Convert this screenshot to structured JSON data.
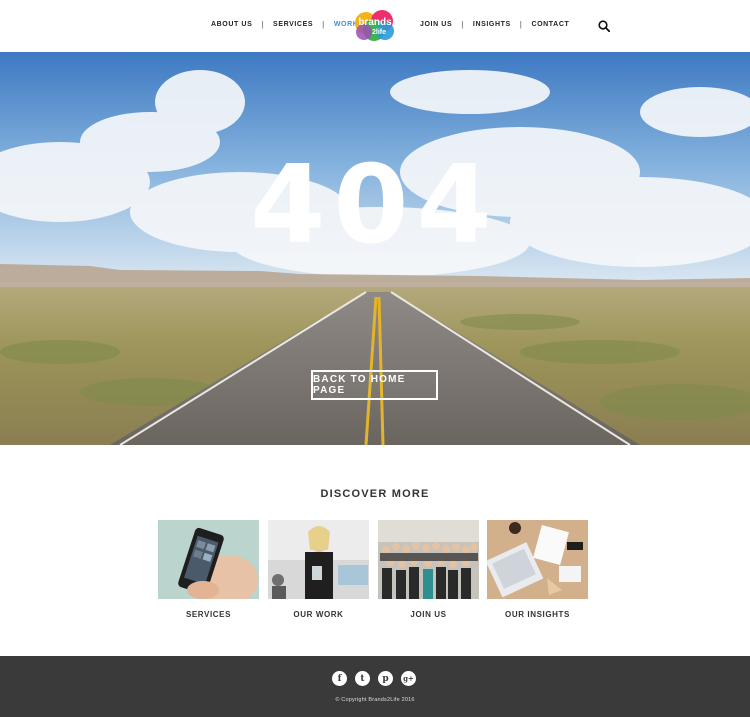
{
  "nav": {
    "left": [
      "ABOUT US",
      "SERVICES",
      "WORK"
    ],
    "right": [
      "JOIN US",
      "INSIGHTS",
      "CONTACT"
    ],
    "separator": "|",
    "active_item": "WORK",
    "active_color": "#3b8fd8"
  },
  "logo": {
    "text_top": "brands",
    "text_bottom": "2life"
  },
  "hero": {
    "error_code": "404",
    "button_label": "BACK TO HOME PAGE"
  },
  "discover": {
    "title": "DISCOVER MORE",
    "cards": [
      {
        "label": "SERVICES",
        "image": "phone-in-hand"
      },
      {
        "label": "OUR WORK",
        "image": "presenter-with-tablet"
      },
      {
        "label": "JOIN US",
        "image": "team-group-photo"
      },
      {
        "label": "OUR INSIGHTS",
        "image": "desk-with-laptop"
      }
    ]
  },
  "footer": {
    "social": [
      {
        "name": "facebook-icon",
        "glyph": "f"
      },
      {
        "name": "twitter-icon",
        "glyph": "t"
      },
      {
        "name": "pinterest-icon",
        "glyph": "p"
      },
      {
        "name": "google-plus-icon",
        "glyph": "g+"
      }
    ],
    "copyright": "© Copyright Brands2Life 2016"
  }
}
